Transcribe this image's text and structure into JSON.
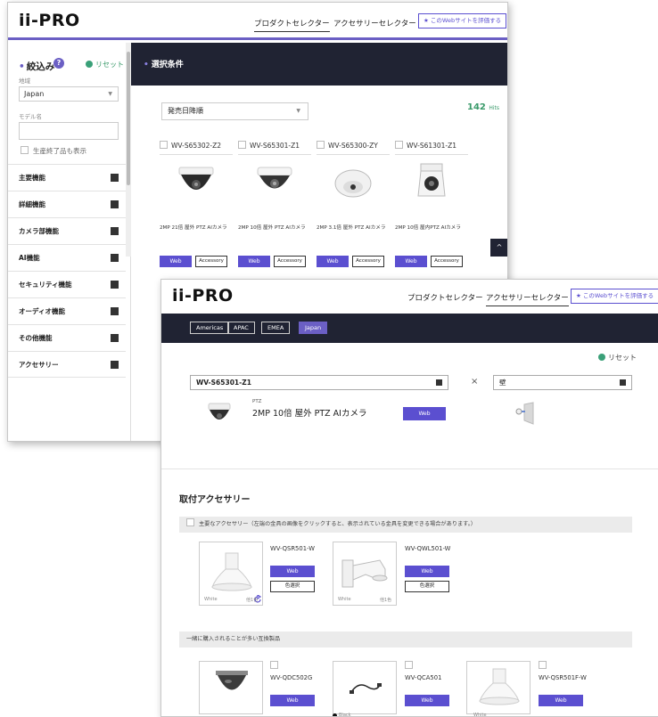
{
  "window1": {
    "logo": "ii-PRO",
    "nav": {
      "product_selector": "プロダクトセレクター",
      "accessory_selector": "アクセサリーセレクター",
      "rate": "★ このWebサイトを評価する"
    },
    "sidebar": {
      "title": "絞込み",
      "help": "?",
      "reset": "リセット",
      "region_label": "地域",
      "region_value": "Japan",
      "model_label": "モデル名",
      "model_value": "",
      "discontinued_label": "生産終了品も表示",
      "facets": [
        "主要機能",
        "詳細機能",
        "カメラ部機能",
        "AI機能",
        "セキュリティ機能",
        "オーディオ機能",
        "その他機能",
        "アクセサリー"
      ]
    },
    "conditions_title": "選択条件",
    "sort_value": "発売日降順",
    "hits": {
      "count": "142",
      "unit": "Hits"
    },
    "products": [
      {
        "model": "WV-S65302-Z2",
        "desc": "2MP 21倍 屋外 PTZ AIカメラ",
        "web": "Web",
        "accessory": "Accessory"
      },
      {
        "model": "WV-S65301-Z1",
        "desc": "2MP 10倍 屋外 PTZ AIカメラ",
        "web": "Web",
        "accessory": "Accessory"
      },
      {
        "model": "WV-S65300-ZY",
        "desc": "2MP 3.1倍 屋外 PTZ AIカメラ",
        "web": "Web",
        "accessory": "Accessory"
      },
      {
        "model": "WV-S61301-Z1",
        "desc": "2MP 10倍 屋内PTZ AIカメラ",
        "web": "Web",
        "accessory": "Accessory"
      }
    ],
    "to_top": "^"
  },
  "window2": {
    "logo": "ii-PRO",
    "nav": {
      "product_selector": "プロダクトセレクター",
      "accessory_selector": "アクセサリーセレクター",
      "rate": "★ このWebサイトを評価する"
    },
    "regions": [
      "Americas",
      "APAC",
      "EMEA",
      "Japan"
    ],
    "reset": "リセット",
    "product_box": "WV-S65301-Z1",
    "times": "×",
    "mount_box": "壁",
    "product_tag": "PTZ",
    "product_title": "2MP 10倍 屋外 PTZ AIカメラ",
    "web": "Web",
    "section_title": "取付アクセサリー",
    "main_acc_label": "主要なアクセサリー（左端の金具の画像をクリックすると、表示されている金具を変更できる場合があります。）",
    "mount_accessories": [
      {
        "model": "WV-QSR501-W",
        "web": "Web",
        "color_btn": "色選択",
        "color": "White",
        "more": "他1色"
      },
      {
        "model": "WV-QWL501-W",
        "web": "Web",
        "color_btn": "色選択",
        "color": "White",
        "more": "他1色"
      }
    ],
    "compat_label": "一緒に購入されることが多い互換製品",
    "compat": [
      {
        "model": "WV-QDC502G",
        "web": "Web",
        "color": ""
      },
      {
        "model": "WV-QCA501",
        "web": "Web",
        "color": "Black"
      },
      {
        "model": "WV-QSR501F-W",
        "web": "Web",
        "color": "White"
      }
    ]
  }
}
